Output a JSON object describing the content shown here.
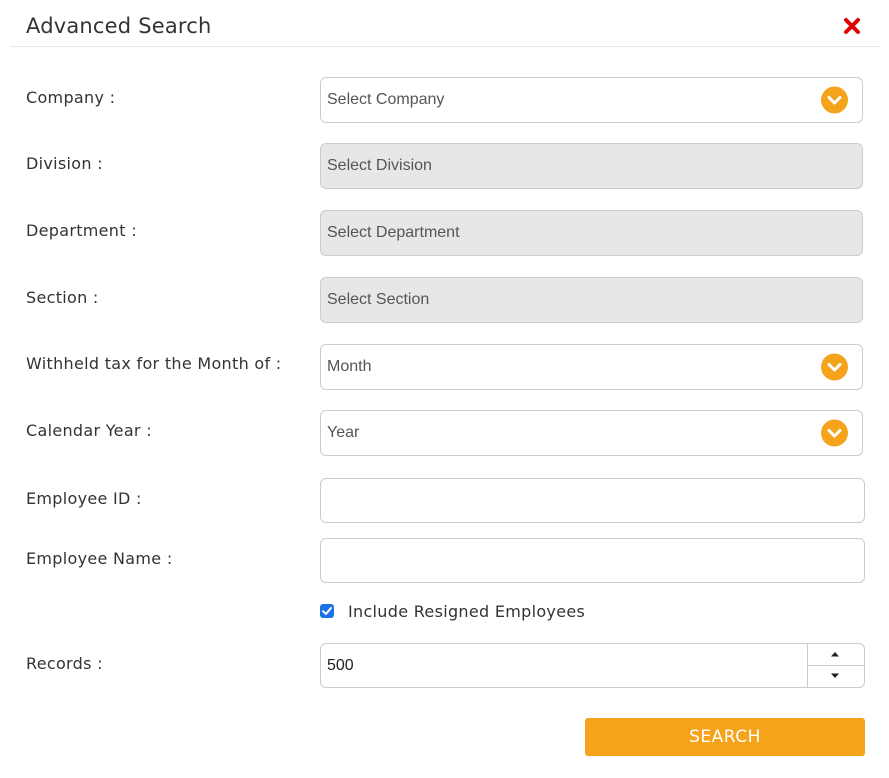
{
  "dialog": {
    "title": "Advanced Search",
    "close_icon": "close-x-icon",
    "accent_color": "#f5a31a",
    "close_color": "#e00000"
  },
  "form": {
    "company": {
      "label": "Company :",
      "value": "Select Company"
    },
    "division": {
      "label": "Division :",
      "value": "Select Division"
    },
    "department": {
      "label": "Department :",
      "value": "Select Department"
    },
    "section": {
      "label": "Section :",
      "value": "Select Section"
    },
    "month": {
      "label": "Withheld tax for the Month of :",
      "value": "Month"
    },
    "year": {
      "label": "Calendar Year :",
      "value": "Year"
    },
    "employee_id": {
      "label": "Employee ID :",
      "value": ""
    },
    "employee_name": {
      "label": "Employee Name :",
      "value": ""
    },
    "include_resigned": {
      "label": "Include Resigned Employees",
      "checked": true
    },
    "records": {
      "label": "Records :",
      "value": "500"
    },
    "search_button": "SEARCH"
  }
}
